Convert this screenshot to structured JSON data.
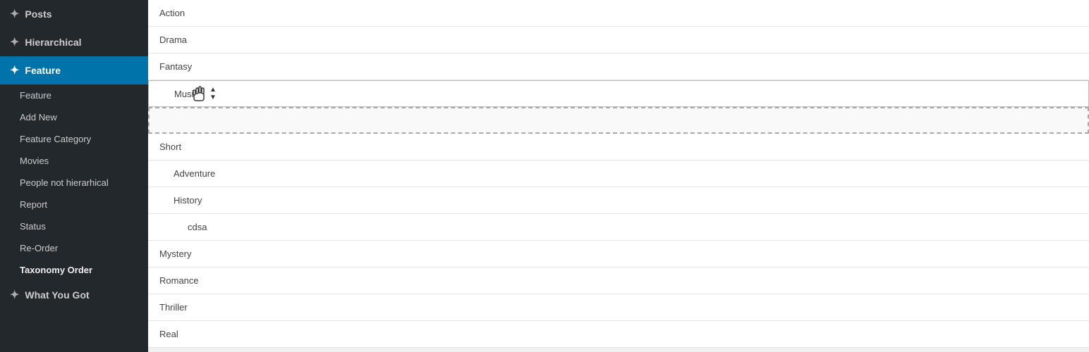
{
  "sidebar": {
    "sections": [
      {
        "id": "posts",
        "label": "Posts",
        "icon": "✦",
        "active": false,
        "items": []
      },
      {
        "id": "hierarchical",
        "label": "Hierarchical",
        "icon": "✦",
        "active": false,
        "items": []
      },
      {
        "id": "feature",
        "label": "Feature",
        "icon": "✦",
        "active": true,
        "items": [
          {
            "id": "feature-link",
            "label": "Feature",
            "bold": false
          },
          {
            "id": "add-new",
            "label": "Add New",
            "bold": false
          },
          {
            "id": "feature-category",
            "label": "Feature Category",
            "bold": false
          },
          {
            "id": "movies",
            "label": "Movies",
            "bold": false
          },
          {
            "id": "people-not-hierarchical",
            "label": "People not hierarhical",
            "bold": false
          },
          {
            "id": "report",
            "label": "Report",
            "bold": false
          },
          {
            "id": "status",
            "label": "Status",
            "bold": false
          },
          {
            "id": "re-order",
            "label": "Re-Order",
            "bold": false
          },
          {
            "id": "taxonomy-order",
            "label": "Taxonomy Order",
            "bold": true
          }
        ]
      },
      {
        "id": "what-you-got",
        "label": "What You Got",
        "icon": "✦",
        "active": false,
        "items": []
      }
    ]
  },
  "main": {
    "rows": [
      {
        "id": "action",
        "label": "Action",
        "level": 0,
        "dragging": false,
        "placeholder": false
      },
      {
        "id": "drama",
        "label": "Drama",
        "level": 0,
        "dragging": false,
        "placeholder": false
      },
      {
        "id": "fantasy",
        "label": "Fantasy",
        "level": 0,
        "dragging": false,
        "placeholder": false
      },
      {
        "id": "music",
        "label": "Music",
        "level": 1,
        "dragging": true,
        "placeholder": false
      },
      {
        "id": "placeholder",
        "label": "",
        "level": 0,
        "dragging": false,
        "placeholder": true
      },
      {
        "id": "short",
        "label": "Short",
        "level": 0,
        "dragging": false,
        "placeholder": false
      },
      {
        "id": "adventure",
        "label": "Adventure",
        "level": 1,
        "dragging": false,
        "placeholder": false
      },
      {
        "id": "history",
        "label": "History",
        "level": 1,
        "dragging": false,
        "placeholder": false
      },
      {
        "id": "cdsa",
        "label": "cdsa",
        "level": 2,
        "dragging": false,
        "placeholder": false
      },
      {
        "id": "mystery",
        "label": "Mystery",
        "level": 0,
        "dragging": false,
        "placeholder": false
      },
      {
        "id": "romance",
        "label": "Romance",
        "level": 0,
        "dragging": false,
        "placeholder": false
      },
      {
        "id": "thriller",
        "label": "Thriller",
        "level": 0,
        "dragging": false,
        "placeholder": false
      },
      {
        "id": "real",
        "label": "Real",
        "level": 0,
        "dragging": false,
        "placeholder": false
      }
    ]
  },
  "icons": {
    "pin": "✦",
    "arrow_up": "▲",
    "arrow_down": "▼"
  }
}
